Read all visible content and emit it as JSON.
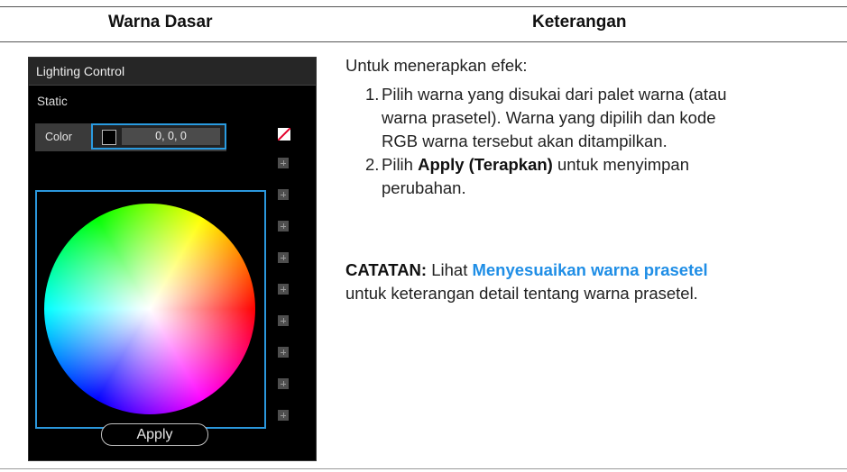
{
  "table": {
    "header_left": "Warna Dasar",
    "header_right": "Keterangan"
  },
  "panel": {
    "title": "Lighting Control",
    "mode": "Static",
    "color_label": "Color",
    "rgb_value": "0, 0, 0",
    "apply_label": "Apply",
    "accent_color": "#2b97dc"
  },
  "description": {
    "intro": "Untuk menerapkan efek:",
    "step1_num": "1.",
    "step1_line1": "Pilih warna yang disukai dari palet warna (atau",
    "step1_line2": "warna prasetel). Warna yang dipilih dan kode",
    "step1_line3": "RGB warna tersebut akan ditampilkan.",
    "step2_num": "2.",
    "step2_pre": "Pilih ",
    "step2_bold": "Apply (Terapkan)",
    "step2_post": " untuk menyimpan",
    "step2_line2": "perubahan.",
    "note_label": "CATATAN:",
    "note_pre": " Lihat ",
    "note_link": "Menyesuaikan warna prasetel",
    "note_line2": "untuk keterangan detail tentang warna prasetel.",
    "link_color": "#1f8ee6"
  }
}
